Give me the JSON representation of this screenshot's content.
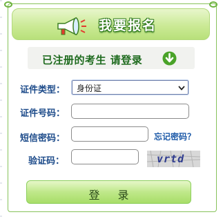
{
  "header": {
    "title": "我要报名"
  },
  "banner": {
    "text": "已注册的考生  请登录"
  },
  "form": {
    "id_type_label": "证件类型：",
    "id_type_value": "身份证",
    "id_number_label": "证件号码：",
    "sms_label": "短信密码：",
    "forgot_link": "忘记密码？",
    "captcha_label": "验证码：",
    "captcha_text": "vrtd"
  },
  "login_button": {
    "label": "登录"
  },
  "colors": {
    "accent_green": "#6cb33e",
    "label_blue": "#1d4b8a",
    "link_blue": "#1d5aa8"
  }
}
